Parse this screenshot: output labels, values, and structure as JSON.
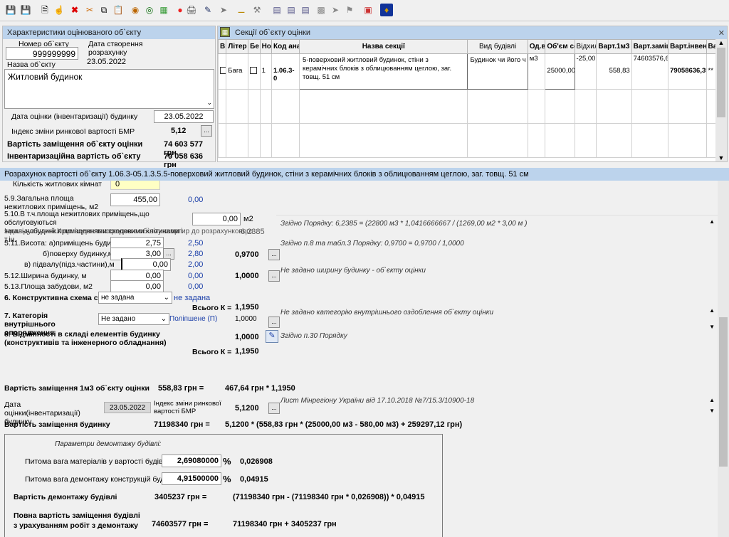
{
  "toolbar": {
    "icons": [
      "save-icon",
      "save-all-icon",
      "new-icon",
      "hand-cursor-icon",
      "delete-icon",
      "cut-icon",
      "copy-icon",
      "paste-icon",
      "target-icon",
      "target-alt-icon",
      "palette-icon",
      "dot-icon",
      "print-icon",
      "edit-icon",
      "forward-icon",
      "ruler-icon",
      "tools-icon",
      "chart-a-icon",
      "chart-b-icon",
      "chart-c-icon",
      "map-icon",
      "pin-icon",
      "flag-icon",
      "layout-icon",
      "emblem-icon"
    ]
  },
  "left": {
    "title": "Характеристики оцінюваного об`єкту",
    "num_label": "Номер об`єкту",
    "num_value": "999999999",
    "date_created_label": "Дата створення розрахунку",
    "date_created_value": "23.05.2022",
    "name_label": "Назва об`єкту",
    "name_value": "Житловий будинок",
    "eval_date_label": "Дата оцінки (інвентаризації) будинку",
    "eval_date_value": "23.05.2022",
    "index_label": "Індекс зміни ринкової вартості БМР",
    "index_value": "5,12",
    "replace_label": "Вартість заміщення об`єкту оцінки",
    "replace_value": "74 603 577 грн",
    "inv_label": "Інвентаризаційна вартість об`єкту",
    "inv_value": "79 058 636 грн",
    "btn_dots": "..."
  },
  "sections": {
    "title": "Секції об`єкту оцінки",
    "columns": [
      "Від",
      "Літер",
      "Бе",
      "Ном",
      "Код ана",
      "Назва секції",
      "Вид будівлі",
      "Од.ви",
      "Об'єм се",
      "Відхил",
      "Варт.1м3 з",
      "Варт.заміще",
      "Варт.інвент",
      "Ва"
    ],
    "row": {
      "vid": "Бага",
      "nom": "1",
      "code": "1.06.3-0",
      "name": "5-поверховий житловий будинок, стіни з керамічних блоків з облицюванням цеглою, заг. товщ. 51 см",
      "building": "Будинок чи його ч",
      "unit": "м3",
      "volume": "25000,00",
      "deviation": "-25,00",
      "cost1m3": "558,83",
      "replace": "74603576,69",
      "inv": "79058636,39",
      "last": "**"
    }
  },
  "calc": {
    "title": "Розрахунок вартості об`єкту 1.06.3-05.1.3.5.5-поверховий житловий будинок, стіни з керамічних блоків з облицюванням цеглою, заг. товщ. 51 см",
    "rooms_label": "Кількість житлових кімнат",
    "rooms_value": "0",
    "nonres_label": "5.9.Загальна площа нежитлових приміщень, м2",
    "nonres_value": "455,00",
    "nonres_blue": "0,00",
    "service_label": "5.10.В т.ч.площа нежитлових приміщень,що обслуговуються загальнобудинк.приміщеннями:сходовими клітинами і т.ін.",
    "service_value": "0,00",
    "service_unit": "м2",
    "indiv_label": "Індивідуальний К приведення корисного об`єму квартир до розрахункового",
    "indiv_value": "6,2385",
    "indiv_note": "Згідно Порядку: 6,2385 = (22800 м3 * 1,0416666667 / (1269,00 м2 * 3,00 м )",
    "height_label": "5.11.Висота: а)приміщень будинку,м",
    "height_value": "2,75",
    "height_blue": "2,50",
    "floor_label": "б)поверху будинку,м",
    "floor_value": "3,00",
    "floor_blue": "2,80",
    "height_k": "0,9700",
    "height_note": "Згідно п.8 та табл.3 Порядку: 0,9700 = 0,9700 / 1,0000",
    "basement_label": "в) підвалу(підз.частини),м",
    "basement_value": "0,00",
    "basement_blue": "2,00",
    "width_label": "5.12.Ширина будинку, м",
    "width_value": "0,00",
    "width_blue": "0,00",
    "width_k": "1,0000",
    "width_note": "Не задано ширину будинку - об`єкту оцінки",
    "area_label": "5.13.Площа забудови, м2",
    "area_value": "0,00",
    "area_blue": "0,00",
    "scheme_label": "6. Конструктивна схема стін",
    "scheme_value": "не задана",
    "scheme_blue": "не задана",
    "total1_label": "Всього К =",
    "total1_value": "1,1950",
    "cat_label": "7. Категорія внутрішнього опорядження",
    "cat_value": "Не задано",
    "cat_blue": "Поліпшене (П)",
    "cat_k": "1,0000",
    "cat_note": "Не задано категорію внутрішнього оздоблення об`єкту оцінки",
    "diff_label": "8. Відмінності в складі елементів будинку (конструктивів та інженерного обладнання)",
    "diff_k": "1,0000",
    "diff_note": "Згідно п.30 Порядку",
    "total2_label": "Всього К =",
    "total2_value": "1,1950",
    "m3_label": "Вартість заміщення 1м3 об`єкту оцінки",
    "m3_value": "558,83 грн =",
    "m3_formula": "467,64 грн * 1,1950",
    "edate_label": "Дата оцінки(інвентаризації) будинку",
    "edate_value": "23.05.2022",
    "idx_label": "Індекс зміни ринкової вартості БМР",
    "idx_value": "5,1200",
    "idx_note": "Лист Мінрегіону України від 17.10.2018 №7/15.3/10900-18",
    "rep_label": "Вартість заміщення будинку",
    "rep_value": "71198340 грн =",
    "rep_formula": "5,1200 * (558,83 грн * (25000,00 м3 - 580,00 м3) + 259297,12 грн)",
    "dem_title": "Параметри демонтажу будівлі:",
    "mat_label": "Питома вага матеріалів у вартості будівлі",
    "mat_value": "2,69080000",
    "mat_pct": "%",
    "mat_k": "0,026908",
    "dem_label": "Питома вага демонтажу конструкцій будівлі",
    "dem_value": "4,91500000",
    "dem_pct": "%",
    "dem_k": "0,04915",
    "demcost_label": "Вартість демонтажу будівлі",
    "demcost_value": "3405237 грн =",
    "demcost_formula": "(71198340 грн - (71198340 грн * 0,026908)) * 0,04915",
    "full_label1": "Повна вартість заміщення будівлі",
    "full_label2": "з урахуванням робіт з демонтажу",
    "full_value": "74603577 грн =",
    "full_formula": "71198340 грн + 3405237 грн"
  },
  "colors": {
    "title_bar": "#bcd3ec",
    "blue_text": "#1a3ea8",
    "yellow": "#ffffc4"
  }
}
